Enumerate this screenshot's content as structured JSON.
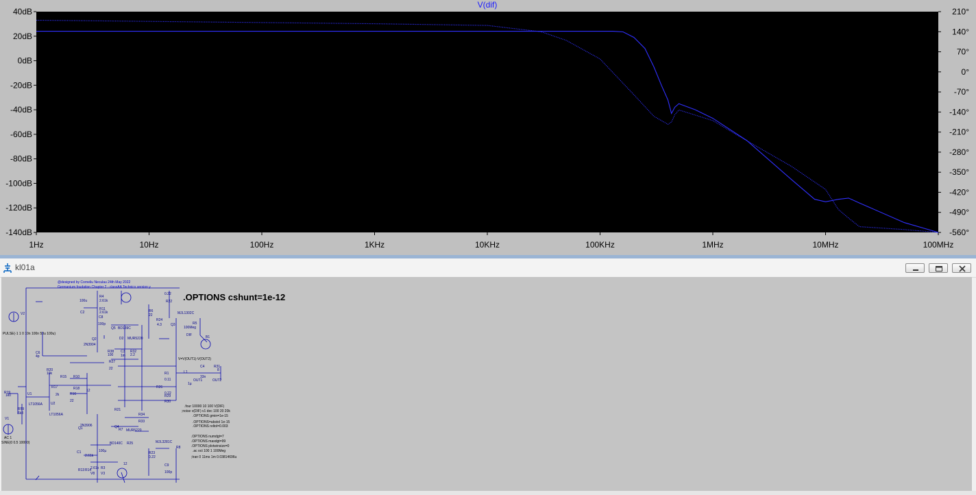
{
  "plot": {
    "title": "V(dif)",
    "colors": {
      "background": "#000000",
      "trace": "#3030ff",
      "frame": "#c0c0c0",
      "title": "#1a1aff"
    },
    "left_axis_labels": [
      "40dB",
      "20dB",
      "0dB",
      "-20dB",
      "-40dB",
      "-60dB",
      "-80dB",
      "-100dB",
      "-120dB",
      "-140dB"
    ],
    "right_axis_labels": [
      "210°",
      "140°",
      "70°",
      "0°",
      "-70°",
      "-140°",
      "-210°",
      "-280°",
      "-350°",
      "-420°",
      "-490°",
      "-560°"
    ],
    "x_axis_labels": [
      "1Hz",
      "10Hz",
      "100Hz",
      "1KHz",
      "10KHz",
      "100KHz",
      "1MHz",
      "10MHz",
      "100MHz"
    ]
  },
  "chart_data": {
    "type": "line",
    "title": "V(dif)",
    "x_scale": "log",
    "xlim": [
      1,
      100000000
    ],
    "ylim": [
      -140,
      40
    ],
    "y2lim": [
      -560,
      210
    ],
    "grid": false,
    "series": [
      {
        "axis": "magnitude_dB",
        "style": "solid",
        "x": [
          1,
          10,
          100,
          1000,
          10000,
          50000,
          100000,
          130000,
          160000,
          200000,
          250000,
          300000,
          350000,
          400000,
          430000,
          460000,
          500000,
          700000,
          1000000,
          2000000,
          5000000,
          8000000,
          10000000,
          13000000,
          16000000,
          20000000,
          50000000,
          100000000
        ],
        "y": [
          24,
          24,
          24,
          24,
          24,
          24,
          24,
          24,
          23.5,
          19,
          10,
          -5,
          -20,
          -32,
          -43,
          -38,
          -35,
          -40,
          -47,
          -65,
          -97,
          -113,
          -115,
          -113,
          -112,
          -116,
          -132,
          -140
        ]
      },
      {
        "axis": "phase_deg",
        "style": "dotted",
        "x": [
          1,
          10,
          100,
          1000,
          10000,
          30000,
          50000,
          100000,
          200000,
          300000,
          400000,
          430000,
          460000,
          500000,
          1000000,
          2000000,
          5000000,
          10000000,
          13000000,
          16000000,
          20000000,
          50000000,
          100000000
        ],
        "y": [
          180,
          176,
          172,
          168,
          162,
          140,
          110,
          45,
          -80,
          -155,
          -183,
          -175,
          -150,
          -133,
          -170,
          -240,
          -330,
          -410,
          -480,
          -510,
          -540,
          -550,
          -560
        ]
      }
    ]
  },
  "schematic": {
    "window_title": "kl01a",
    "options_directive": ".OPTIONS cshunt=1e-12",
    "credit_line1": "@designed by Corneliu Neculau 24th May 2022",
    "credit_line2": "Germanium foudation Chapter 2 - classAA Technics version y",
    "source_pulse": "PULSE(-1 1 0 10n 100n 50u 100u)",
    "source_ac_line1": "AC 1",
    "source_ac_line2": "SINE(0 0.5 10000)",
    "behavioral_source": "V=V(OUT1)-V(OUT2)",
    "directives": [
      ".four 10000 10 100 V(DIF)",
      ";noise v(DIF) v1 dec 100 20 20k",
      ".OPTIONS gmin=1e-15",
      ".OPTIONS=abstol 1e-15",
      ".OPTIONS reltol=0.003",
      ".OPTIONS numdgt=7",
      ".OPTIONS maxdgt=99",
      ".OPTIONS plotwinsize=0",
      ".ac oct 100 1 100Meg",
      ";tran 0 11ms 1m 0.03814696u"
    ],
    "part_labels": [
      "V2",
      "V1",
      "C6",
      "4p",
      "R20",
      "10k",
      "R15",
      "R10",
      "R17",
      "R18",
      "R16",
      "12",
      "22",
      "2k",
      "U1",
      "U2",
      "LT1056A",
      "LT1056A",
      "R19",
      "1k0",
      "R59",
      "6k8",
      "R4",
      "2.61k",
      "R11",
      "2.61k",
      "100u",
      "C2",
      "C8",
      "100p",
      "Q2",
      "2N3904",
      "R38",
      "100",
      "Q5",
      "BD139C",
      "D2",
      "MUR5220",
      "C3",
      "1m",
      "R32",
      "2.2",
      "R27",
      "22",
      "R6",
      "22",
      "R24",
      "4.3",
      "Q3",
      "MJL1302C",
      "0.22",
      "R22",
      "R5",
      "100Meg",
      "B1",
      "DIF",
      "C4",
      "33n",
      "R31",
      "8",
      "R1",
      "R26",
      "OUT1",
      "OUT2",
      "L1",
      "1µ",
      "0.11",
      "0.22",
      "R29",
      "R30",
      "R21",
      "R7",
      "R34",
      "R33",
      "MUR5220",
      "2N3906",
      "Q1",
      "Q4",
      "BD140C",
      "R25",
      "MJL3281C",
      "R8",
      "R23",
      "0.22",
      "100p",
      "C9",
      "C1",
      "100µ",
      "R13",
      "2.61k",
      "R14",
      "2.61k",
      "V8",
      "R3",
      "V3",
      "12"
    ]
  }
}
